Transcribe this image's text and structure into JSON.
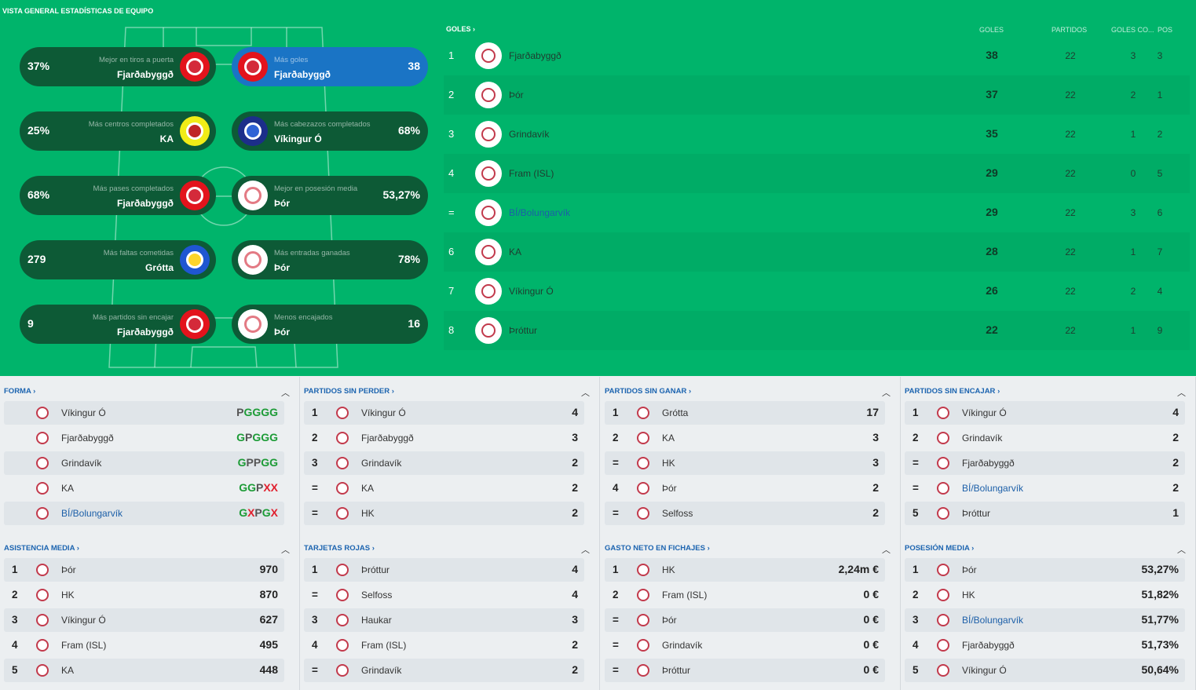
{
  "title": "VISTA GENERAL ESTADÍSTICAS DE EQUIPO",
  "cards": [
    {
      "side": "left",
      "value": "37%",
      "label": "Mejor en tiros a puerta",
      "team": "Fjarðabyggð",
      "crest": "red"
    },
    {
      "side": "right",
      "value": "38",
      "label": "Más goles",
      "team": "Fjarðabyggð",
      "crest": "red",
      "highlight": true
    },
    {
      "side": "left",
      "value": "25%",
      "label": "Más centros completados",
      "team": "KA",
      "crest": "yellow"
    },
    {
      "side": "right",
      "value": "68%",
      "label": "Más cabezazos completados",
      "team": "Víkingur Ó",
      "crest": "navy"
    },
    {
      "side": "left",
      "value": "68%",
      "label": "Más pases completados",
      "team": "Fjarðabyggð",
      "crest": "red"
    },
    {
      "side": "right",
      "value": "53,27%",
      "label": "Mejor en posesión media",
      "team": "Þór",
      "crest": "white"
    },
    {
      "side": "left",
      "value": "279",
      "label": "Más faltas cometidas",
      "team": "Grótta",
      "crest": "blue"
    },
    {
      "side": "right",
      "value": "78%",
      "label": "Más entradas ganadas",
      "team": "Þór",
      "crest": "white"
    },
    {
      "side": "left",
      "value": "9",
      "label": "Más partidos sin encajar",
      "team": "Fjarðabyggð",
      "crest": "red"
    },
    {
      "side": "right",
      "value": "16",
      "label": "Menos encajados",
      "team": "Þór",
      "crest": "white"
    }
  ],
  "goles": {
    "title": "GOLES",
    "headers": {
      "goles": "GOLES",
      "partidos": "PARTIDOS",
      "gc": "GOLES CO...",
      "pos": "POS"
    },
    "rows": [
      {
        "rank": "1",
        "team": "Fjarðabyggð",
        "goals": "38",
        "games": "22",
        "gc": "3",
        "pos": "3"
      },
      {
        "rank": "2",
        "team": "Þór",
        "goals": "37",
        "games": "22",
        "gc": "2",
        "pos": "1"
      },
      {
        "rank": "3",
        "team": "Grindavík",
        "goals": "35",
        "games": "22",
        "gc": "1",
        "pos": "2"
      },
      {
        "rank": "4",
        "team": "Fram (ISL)",
        "goals": "29",
        "games": "22",
        "gc": "0",
        "pos": "5"
      },
      {
        "rank": "=",
        "team": "BÍ/Bolungarvík",
        "goals": "29",
        "games": "22",
        "gc": "3",
        "pos": "6",
        "link": true
      },
      {
        "rank": "6",
        "team": "KA",
        "goals": "28",
        "games": "22",
        "gc": "1",
        "pos": "7"
      },
      {
        "rank": "7",
        "team": "Víkingur Ó",
        "goals": "26",
        "games": "22",
        "gc": "2",
        "pos": "4"
      },
      {
        "rank": "8",
        "team": "Þróttur",
        "goals": "22",
        "games": "22",
        "gc": "1",
        "pos": "9"
      }
    ]
  },
  "panels": [
    {
      "title": "FORMA",
      "form": true,
      "rows": [
        {
          "rank": "",
          "team": "Víkingur Ó",
          "value": "PGGGG"
        },
        {
          "rank": "",
          "team": "Fjarðabyggð",
          "value": "GPGGG"
        },
        {
          "rank": "",
          "team": "Grindavík",
          "value": "GPPGG"
        },
        {
          "rank": "",
          "team": "KA",
          "value": "GGPXX"
        },
        {
          "rank": "",
          "team": "BÍ/Bolungarvík",
          "value": "GXPGX",
          "link": true
        }
      ]
    },
    {
      "title": "PARTIDOS SIN PERDER",
      "rows": [
        {
          "rank": "1",
          "team": "Víkingur Ó",
          "value": "4"
        },
        {
          "rank": "2",
          "team": "Fjarðabyggð",
          "value": "3"
        },
        {
          "rank": "3",
          "team": "Grindavík",
          "value": "2"
        },
        {
          "rank": "=",
          "team": "KA",
          "value": "2"
        },
        {
          "rank": "=",
          "team": "HK",
          "value": "2"
        }
      ]
    },
    {
      "title": "PARTIDOS SIN GANAR",
      "rows": [
        {
          "rank": "1",
          "team": "Grótta",
          "value": "17"
        },
        {
          "rank": "2",
          "team": "KA",
          "value": "3"
        },
        {
          "rank": "=",
          "team": "HK",
          "value": "3"
        },
        {
          "rank": "4",
          "team": "Þór",
          "value": "2"
        },
        {
          "rank": "=",
          "team": "Selfoss",
          "value": "2"
        }
      ]
    },
    {
      "title": "PARTIDOS SIN ENCAJAR",
      "rows": [
        {
          "rank": "1",
          "team": "Víkingur Ó",
          "value": "4"
        },
        {
          "rank": "2",
          "team": "Grindavík",
          "value": "2"
        },
        {
          "rank": "=",
          "team": "Fjarðabyggð",
          "value": "2"
        },
        {
          "rank": "=",
          "team": "BÍ/Bolungarvík",
          "value": "2",
          "link": true
        },
        {
          "rank": "5",
          "team": "Þróttur",
          "value": "1"
        }
      ]
    },
    {
      "title": "ASISTENCIA MEDIA",
      "rows": [
        {
          "rank": "1",
          "team": "Þór",
          "value": "970"
        },
        {
          "rank": "2",
          "team": "HK",
          "value": "870"
        },
        {
          "rank": "3",
          "team": "Víkingur Ó",
          "value": "627"
        },
        {
          "rank": "4",
          "team": "Fram (ISL)",
          "value": "495"
        },
        {
          "rank": "5",
          "team": "KA",
          "value": "448"
        }
      ]
    },
    {
      "title": "TARJETAS ROJAS",
      "rows": [
        {
          "rank": "1",
          "team": "Þróttur",
          "value": "4"
        },
        {
          "rank": "=",
          "team": "Selfoss",
          "value": "4"
        },
        {
          "rank": "3",
          "team": "Haukar",
          "value": "3"
        },
        {
          "rank": "4",
          "team": "Fram (ISL)",
          "value": "2"
        },
        {
          "rank": "=",
          "team": "Grindavík",
          "value": "2"
        }
      ]
    },
    {
      "title": "GASTO NETO EN FICHAJES",
      "rows": [
        {
          "rank": "1",
          "team": "HK",
          "value": "2,24m €"
        },
        {
          "rank": "2",
          "team": "Fram (ISL)",
          "value": "0 €"
        },
        {
          "rank": "=",
          "team": "Þór",
          "value": "0 €"
        },
        {
          "rank": "=",
          "team": "Grindavík",
          "value": "0 €"
        },
        {
          "rank": "=",
          "team": "Þróttur",
          "value": "0 €"
        }
      ]
    },
    {
      "title": "POSESIÓN MEDIA",
      "rows": [
        {
          "rank": "1",
          "team": "Þór",
          "value": "53,27%"
        },
        {
          "rank": "2",
          "team": "HK",
          "value": "51,82%"
        },
        {
          "rank": "3",
          "team": "BÍ/Bolungarvík",
          "value": "51,77%",
          "link": true
        },
        {
          "rank": "4",
          "team": "Fjarðabyggð",
          "value": "51,73%"
        },
        {
          "rank": "5",
          "team": "Víkingur Ó",
          "value": "50,64%"
        }
      ]
    }
  ]
}
